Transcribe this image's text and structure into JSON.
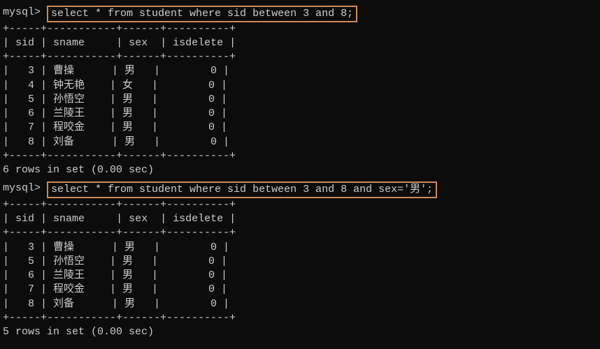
{
  "query1": {
    "prompt": "mysql> ",
    "sql": "select * from student where sid between 3 and 8;",
    "headers": {
      "sid": "sid",
      "sname": "sname",
      "sex": "sex",
      "isdelete": "isdelete"
    },
    "rows": [
      {
        "sid": "3",
        "sname": "曹操",
        "sex": "男",
        "isdelete": "0"
      },
      {
        "sid": "4",
        "sname": "钟无艳",
        "sex": "女",
        "isdelete": "0"
      },
      {
        "sid": "5",
        "sname": "孙悟空",
        "sex": "男",
        "isdelete": "0"
      },
      {
        "sid": "6",
        "sname": "兰陵王",
        "sex": "男",
        "isdelete": "0"
      },
      {
        "sid": "7",
        "sname": "程咬金",
        "sex": "男",
        "isdelete": "0"
      },
      {
        "sid": "8",
        "sname": "刘备",
        "sex": "男",
        "isdelete": "0"
      }
    ],
    "footer": "6 rows in set (0.00 sec)"
  },
  "query2": {
    "prompt": "mysql> ",
    "sql": "select * from student where sid between 3 and 8 and sex='男';",
    "headers": {
      "sid": "sid",
      "sname": "sname",
      "sex": "sex",
      "isdelete": "isdelete"
    },
    "rows": [
      {
        "sid": "3",
        "sname": "曹操",
        "sex": "男",
        "isdelete": "0"
      },
      {
        "sid": "5",
        "sname": "孙悟空",
        "sex": "男",
        "isdelete": "0"
      },
      {
        "sid": "6",
        "sname": "兰陵王",
        "sex": "男",
        "isdelete": "0"
      },
      {
        "sid": "7",
        "sname": "程咬金",
        "sex": "男",
        "isdelete": "0"
      },
      {
        "sid": "8",
        "sname": "刘备",
        "sex": "男",
        "isdelete": "0"
      }
    ],
    "footer": "5 rows in set (0.00 sec)"
  },
  "table_border": {
    "sep": "+-----+-----------+------+----------+",
    "header_row": "| sid | sname     | sex  | isdelete |"
  }
}
